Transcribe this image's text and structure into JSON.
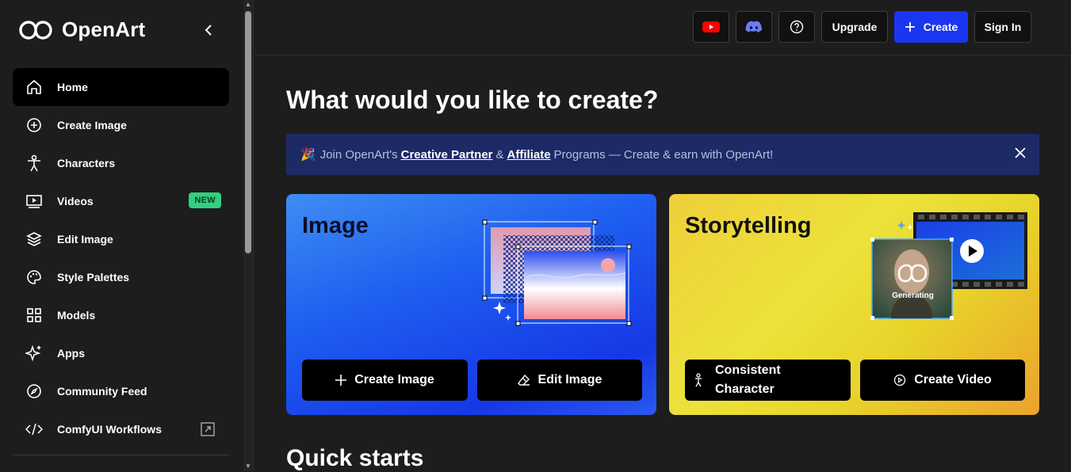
{
  "app": {
    "name": "OpenArt"
  },
  "sidebar": {
    "items": [
      {
        "label": "Home"
      },
      {
        "label": "Create Image"
      },
      {
        "label": "Characters"
      },
      {
        "label": "Videos",
        "badge": "NEW"
      },
      {
        "label": "Edit Image"
      },
      {
        "label": "Style Palettes"
      },
      {
        "label": "Models"
      },
      {
        "label": "Apps"
      },
      {
        "label": "Community Feed"
      },
      {
        "label": "ComfyUI Workflows"
      }
    ]
  },
  "topbar": {
    "upgrade": "Upgrade",
    "create": "Create",
    "signin": "Sign In"
  },
  "main": {
    "heading": "What would you like to create?",
    "banner": {
      "emoji": "🎉",
      "prefix": "Join OpenArt's",
      "link1": "Creative Partner",
      "amp": "&",
      "link2": "Affiliate",
      "suffix": "Programs — Create & earn with OpenArt!"
    },
    "image_card": {
      "title": "Image",
      "btn_create": "Create Image",
      "btn_edit": "Edit Image"
    },
    "story_card": {
      "title": "Storytelling",
      "generating": "Generating",
      "btn_character": "Consistent Character",
      "btn_video": "Create Video"
    },
    "quick_starts": "Quick starts"
  },
  "colors": {
    "accent": "#1a36f0",
    "badge": "#2fd07f",
    "banner": "#1e2a66"
  }
}
